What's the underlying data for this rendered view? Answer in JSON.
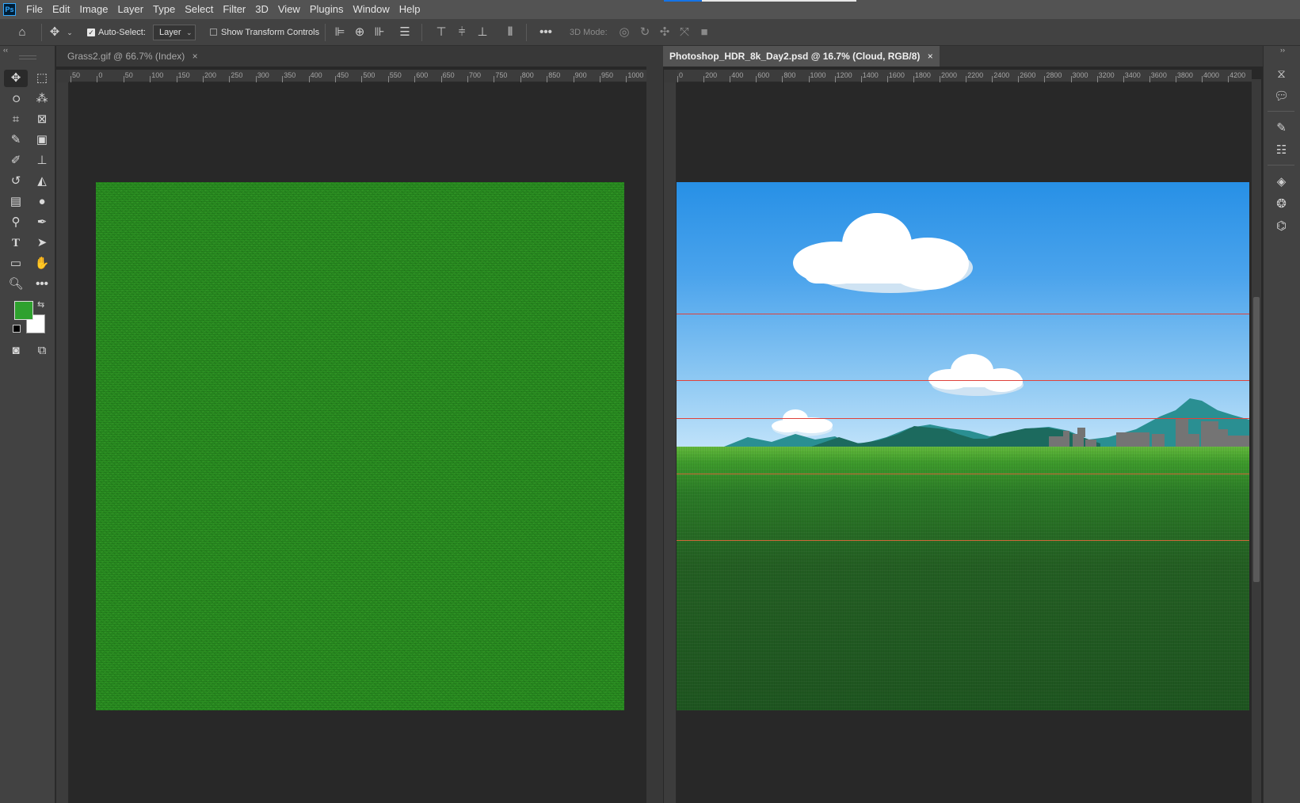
{
  "menubar": {
    "logo": "Ps",
    "items": [
      "File",
      "Edit",
      "Image",
      "Layer",
      "Type",
      "Select",
      "Filter",
      "3D",
      "View",
      "Plugins",
      "Window",
      "Help"
    ]
  },
  "options": {
    "auto_select_label": "Auto-Select:",
    "auto_select_checked": true,
    "layer_value": "Layer",
    "show_transform_label": "Show Transform Controls",
    "mode_3d_label": "3D Mode:"
  },
  "documents": {
    "left": {
      "tab_title": "Grass2.gif @ 66.7% (Index)",
      "close": "×",
      "ruler_ticks": [
        "50",
        "0",
        "50",
        "100",
        "150",
        "200",
        "250",
        "300",
        "350",
        "400",
        "450",
        "500",
        "550",
        "600",
        "650",
        "700",
        "750",
        "800",
        "850",
        "900",
        "950",
        "1000"
      ]
    },
    "right": {
      "tab_title": "Photoshop_HDR_8k_Day2.psd @ 16.7% (Cloud, RGB/8)",
      "close": "×",
      "ruler_ticks": [
        "0",
        "200",
        "400",
        "600",
        "800",
        "1000",
        "1200",
        "1400",
        "1600",
        "1800",
        "2000",
        "2200",
        "2400",
        "2600",
        "2800",
        "3000",
        "3200",
        "3400",
        "3600",
        "3800",
        "4000",
        "4200"
      ]
    }
  },
  "colors": {
    "foreground": "#2ea12e",
    "background": "#ffffff",
    "guide_red": "#e0413a",
    "guide_orange": "#e07a3a"
  },
  "tools": [
    "move-tool",
    "marquee-tool",
    "lasso-tool",
    "magic-wand-tool",
    "crop-tool",
    "frame-tool",
    "eyedropper-tool",
    "patch-tool",
    "brush-tool",
    "stamp-tool",
    "history-brush-tool",
    "eraser-tool",
    "gradient-tool",
    "blur-tool",
    "dodge-tool",
    "pen-tool",
    "type-tool",
    "path-select-tool",
    "rectangle-tool",
    "hand-tool",
    "zoom-tool",
    "more-tools"
  ],
  "dock_icons": [
    "history-icon",
    "comment-icon",
    "brushes-icon",
    "properties-icon",
    "layers-icon",
    "channels-icon",
    "paths-icon"
  ]
}
